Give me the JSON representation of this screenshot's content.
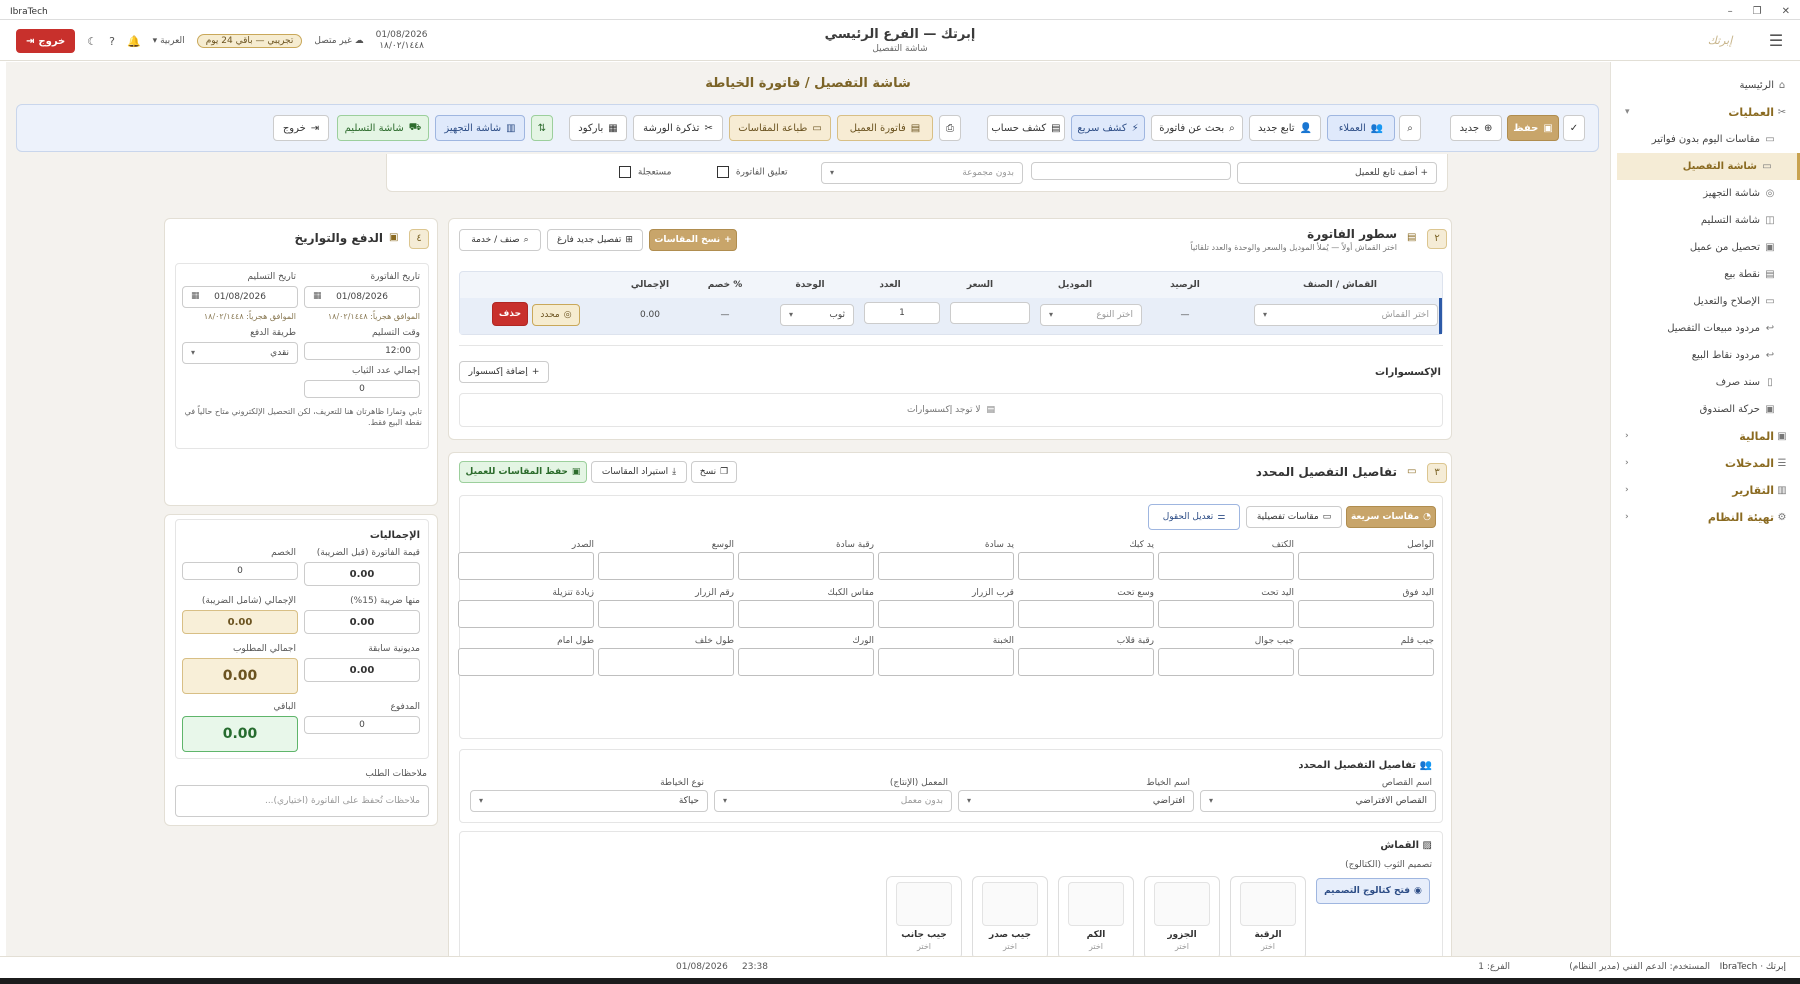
{
  "app": {
    "name": "IbraTech"
  },
  "window": {
    "min": "–",
    "max": "❐",
    "close": "✕"
  },
  "topbar": {
    "branch_title": "إبرتك — الفرع الرئيسي",
    "screen_name": "شاشة التفصيل",
    "exit_label": "خروج",
    "trial": "تجريبي — باقي 24 يوم",
    "language": "العربية",
    "offline": "غير متصل",
    "date_greg": "01/08/2026",
    "date_hijri": "١٨/٠٢/١٤٤٨",
    "logo_text": "إبرتك"
  },
  "sidebar": {
    "home": "الرئيسية",
    "operations": "العمليات",
    "items": [
      "مقاسات اليوم بدون فواتير",
      "شاشة التفصيل",
      "شاشة التجهيز",
      "شاشة التسليم",
      "تحصيل من عميل",
      "نقطة بيع",
      "الإصلاح والتعديل",
      "مردود مبيعات التفصيل",
      "مردود نقاط البيع",
      "سند صرف",
      "حركة الصندوق"
    ],
    "sections": [
      "المالية",
      "المدخلات",
      "التقارير",
      "تهيئة النظام"
    ]
  },
  "page": {
    "title": "شاشة التفصيل / فاتورة الخياطة"
  },
  "toolbar": {
    "save": "حفظ",
    "new": "جديد",
    "customers": "العملاء",
    "new_follower": "تابع جديد",
    "search_invoice": "بحث عن فاتورة",
    "quick_statement": "كشف سريع",
    "account_statement": "كشف حساب",
    "customer_invoice": "فاتورة العميل",
    "print_measurements": "طباعة المقاسات",
    "workshop_ticket": "تذكرة الورشة",
    "barcode": "باركود",
    "prep_screen": "شاشة التجهيز",
    "delivery_screen": "شاشة التسليم",
    "exit": "خروج"
  },
  "customer_row": {
    "add_follower": "أضف تابع للعميل",
    "group_placeholder": "بدون مجموعة",
    "suspend_invoice": "تعليق الفاتورة",
    "urgent": "مستعجلة"
  },
  "invoice_lines": {
    "num": "٢",
    "title": "سطور الفاتورة",
    "subtitle": "اختر القماش أولاً — يُملأ الموديل والسعر والوحدة والعدد تلقائياً",
    "copy_measurements": "نسخ المقاسات",
    "new_empty_detail": "تفصيل جديد فارغ",
    "item_service": "صنف / خدمة",
    "columns": [
      "القماش / الصنف",
      "الرصيد",
      "الموديل",
      "السعر",
      "العدد",
      "الوحدة",
      "خصم %",
      "الإجمالي"
    ],
    "row": {
      "fabric_placeholder": "اختر القماش",
      "balance": "—",
      "model_placeholder": "اختر النوع",
      "price": "",
      "qty": "1",
      "unit": "ثوب",
      "discount": "—",
      "total": "0.00",
      "selected": "محدد",
      "delete": "حذف"
    },
    "accessories_title": "الإكسسوارات",
    "add_accessory": "إضافة إكسسوار",
    "no_accessories": "لا توجد إكسسوارات"
  },
  "details": {
    "num": "٣",
    "title": "تفاصيل التفصيل المحدد",
    "copy": "نسخ",
    "import_measurements": "استيراد المقاسات",
    "save_measurements": "حفظ المقاسات للعميل",
    "quick_measurements": "مقاسات سريعة",
    "detailed_measurements": "مقاسات تفصيلية",
    "edit_fields": "تعديل الحقول",
    "fields_row1": [
      "الواصل",
      "الكتف",
      "يد كبك",
      "يد سادة",
      "رقبة سادة",
      "الوسع",
      "الصدر"
    ],
    "fields_row2": [
      "اليد فوق",
      "اليد تحت",
      "وسع تحت",
      "قرب الزرار",
      "مقاس الكبك",
      "رقم الزرار",
      "زيادة تنزيلة"
    ],
    "fields_row3": [
      "جيب قلم",
      "جيب جوال",
      "رقبة قلاب",
      "الخبنة",
      "الورك",
      "طول خلف",
      "طول امام"
    ],
    "selected_title": "تفاصيل التفصيل المحدد",
    "tailor_cutter_label": "اسم القصاص",
    "tailor_cutter_value": "القصاص الافتراضي",
    "tailor_label": "اسم الخياط",
    "tailor_value": "افتراضي",
    "lab_label": "المعمل (الإنتاج)",
    "lab_value": "بدون معمل",
    "sewing_type_label": "نوع الخياطة",
    "sewing_type_value": "حياكة",
    "fabric_title": "القماش",
    "design_label": "تصميم الثوب (الكتالوج)",
    "open_catalog": "فتح كتالوج التصميم",
    "tiles": [
      {
        "name": "الرقبة",
        "sub": "اختر"
      },
      {
        "name": "الجزور",
        "sub": "اختر"
      },
      {
        "name": "الكم",
        "sub": "اختر"
      },
      {
        "name": "جيب صدر",
        "sub": "اختر"
      },
      {
        "name": "جيب جانب",
        "sub": "اختر"
      }
    ]
  },
  "payment": {
    "num": "٤",
    "title": "الدفع والتواريخ",
    "invoice_date_label": "تاريخ الفاتورة",
    "invoice_date": "01/08/2026",
    "invoice_hijri": "الموافق هجرياً: ١٨/٠٢/١٤٤٨",
    "delivery_date_label": "تاريخ التسليم",
    "delivery_date": "01/08/2026",
    "delivery_hijri": "الموافق هجرياً: ١٨/٠٢/١٤٤٨",
    "delivery_time_label": "وقت التسليم",
    "delivery_time": "12:00",
    "payment_method_label": "طريقة الدفع",
    "payment_method": "نقدي",
    "total_pieces_label": "إجمالي عدد الثياب",
    "total_pieces": "0",
    "note": "تابي وتمارا ظاهرتان هنا للتعريف، لكن التحصيل الإلكتروني متاح حالياً في نقطة البيع فقط."
  },
  "totals": {
    "title": "الإجماليات",
    "pre_tax_label": "قيمة الفاتورة (قبل الضريبة)",
    "pre_tax": "0.00",
    "discount_label": "الخصم",
    "discount": "0",
    "tax_label": "منها ضريبة (15%)",
    "tax": "0.00",
    "total_with_tax_label": "الإجمالي (شامل الضريبة)",
    "total_with_tax": "0.00",
    "previous_debt_label": "مديونية سابقة",
    "previous_debt": "0.00",
    "total_due_label": "اجمالي المطلوب",
    "total_due": "0.00",
    "paid_label": "المدفوع",
    "paid": "0",
    "remaining_label": "الباقي",
    "remaining": "0.00",
    "notes_label": "ملاحظات الطلب",
    "notes_placeholder": "ملاحظات تُحفظ على الفاتورة (اختياري)..."
  },
  "statusbar": {
    "company": "إبرتك · IbraTech",
    "branch": "الفرع: 1",
    "user": "المستخدم: الدعم الفني (مدير النظام)",
    "time": "23:38",
    "date": "01/08/2026"
  },
  "colors": {
    "accent": "#c8a56a",
    "danger": "#c8302c",
    "success": "#e8f7ea",
    "highlight": "#f8efd8"
  }
}
